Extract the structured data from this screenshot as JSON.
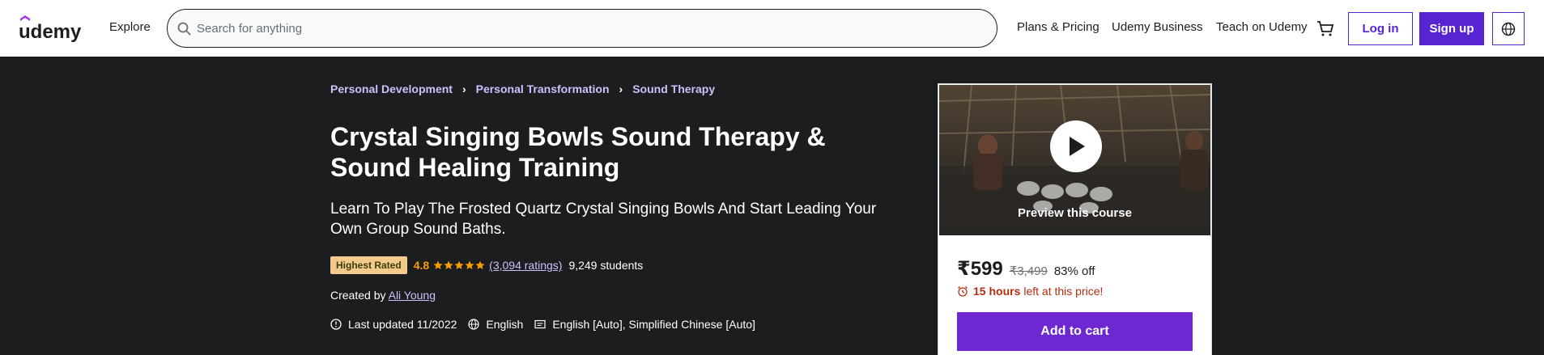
{
  "header": {
    "logo_text": "udemy",
    "explore": "Explore",
    "search_placeholder": "Search for anything",
    "plans_pricing": "Plans & Pricing",
    "business": "Udemy Business",
    "teach": "Teach on Udemy",
    "login": "Log in",
    "signup": "Sign up"
  },
  "breadcrumb": [
    "Personal Development",
    "Personal Transformation",
    "Sound Therapy"
  ],
  "course": {
    "title": "Crystal Singing Bowls Sound Therapy & Sound Healing Training",
    "subtitle": "Learn To Play The Frosted Quartz Crystal Singing Bowls And Start Leading Your Own Group Sound Baths.",
    "badge": "Highest Rated",
    "rating": "4.8",
    "stars": 5,
    "ratings_count": "(3,094 ratings)",
    "students": "9,249 students",
    "created_by_label": "Created by",
    "author": "Ali Young",
    "last_updated": "Last updated 11/2022",
    "language": "English",
    "captions": "English [Auto], Simplified Chinese [Auto]"
  },
  "card": {
    "preview_label": "Preview this course",
    "price": "₹599",
    "original_price": "₹3,499",
    "discount": "83% off",
    "timer_bold": "15 hours",
    "timer_rest": "left at this price!",
    "add_to_cart": "Add to cart"
  },
  "colors": {
    "brand_purple": "#5624d0",
    "cta_purple": "#6d28d2",
    "dark_bg": "#1c1d1f",
    "link_lavender": "#cec0fc",
    "star_orange": "#f69c08",
    "badge_bg": "#f3ca8c",
    "timer_red": "#b32d0f"
  }
}
